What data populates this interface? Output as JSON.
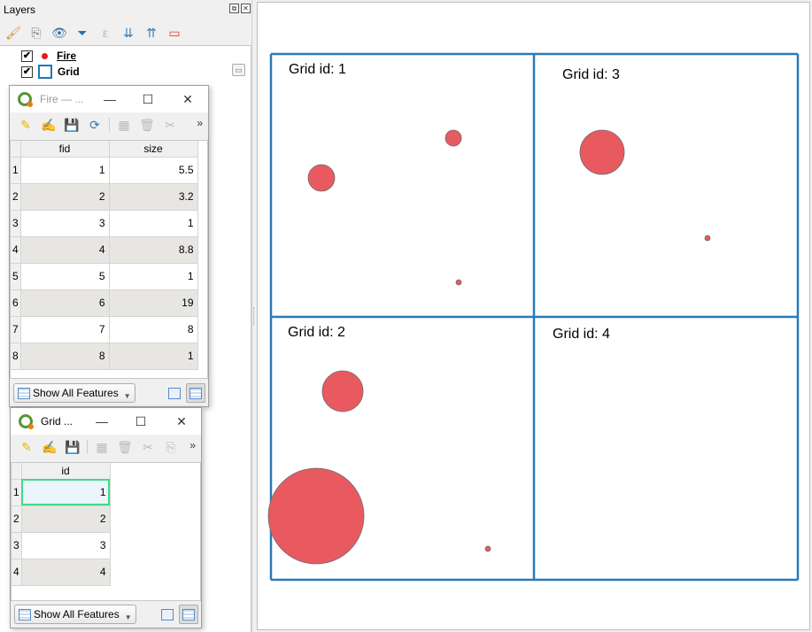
{
  "layers_panel": {
    "title": "Layers",
    "toolbar_icons": [
      "style-brush-icon",
      "add-group-icon",
      "eye-visibility-icon",
      "filter-legend-icon",
      "expression-filter-icon",
      "expand-all-icon",
      "collapse-all-icon",
      "remove-layer-icon"
    ],
    "layers": [
      {
        "name": "Fire",
        "checked": true,
        "symbol": "point",
        "color": "#e31a1c"
      },
      {
        "name": "Grid",
        "checked": true,
        "symbol": "polygon",
        "color": "#1f78b4"
      }
    ]
  },
  "fire_table": {
    "title": "Fire — ...",
    "columns": [
      "fid",
      "size"
    ],
    "rows": [
      {
        "row": "1",
        "fid": "1",
        "size": "5.5"
      },
      {
        "row": "2",
        "fid": "2",
        "size": "3.2"
      },
      {
        "row": "3",
        "fid": "3",
        "size": "1"
      },
      {
        "row": "4",
        "fid": "4",
        "size": "8.8"
      },
      {
        "row": "5",
        "fid": "5",
        "size": "1"
      },
      {
        "row": "6",
        "fid": "6",
        "size": "19"
      },
      {
        "row": "7",
        "fid": "7",
        "size": "8"
      },
      {
        "row": "8",
        "fid": "8",
        "size": "1"
      }
    ],
    "filter_label": "Show All Features",
    "more": "»"
  },
  "grid_table": {
    "title": "Grid ...",
    "columns": [
      "id"
    ],
    "rows": [
      {
        "row": "1",
        "id": "1"
      },
      {
        "row": "2",
        "id": "2"
      },
      {
        "row": "3",
        "id": "3"
      },
      {
        "row": "4",
        "id": "4"
      }
    ],
    "filter_label": "Show All Features",
    "more": "»"
  },
  "window_controls": {
    "minimize": "—",
    "maximize": "☐",
    "close": "✕"
  },
  "map": {
    "grid_color": "#2a7ab8",
    "point_color": "#e85a60",
    "cells": [
      {
        "label": "Grid id: 1"
      },
      {
        "label": "Grid id: 3"
      },
      {
        "label": "Grid id: 2"
      },
      {
        "label": "Grid id: 4"
      }
    ]
  }
}
